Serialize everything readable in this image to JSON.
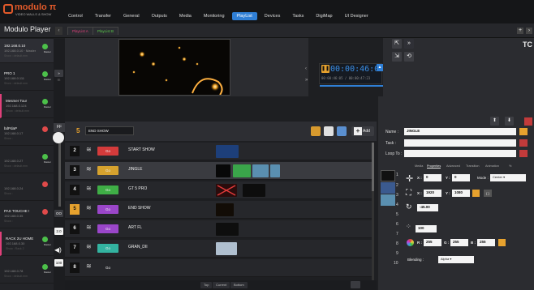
{
  "header": {
    "brand": "modulo",
    "brand_symbol": "π",
    "tagline": "VIDEO WALLS & SHOW",
    "menu": [
      "Control",
      "Transfer",
      "General",
      "Outputs",
      "Media",
      "Monitoring",
      "PlayList",
      "Devices",
      "Tasks",
      "DigiMap",
      "UI Designer"
    ],
    "active_menu": "PlayList"
  },
  "subheader": {
    "app_title": "Modulo Player",
    "collapse_icon": "chevron-left-icon",
    "tabs": [
      "PlayList A",
      "PlayList B"
    ],
    "add_label": "+",
    "next_label": "›"
  },
  "servers": [
    {
      "name": "192.168.0.10",
      "ip": "192.168.0.10 · Master",
      "status": "Show : default.mm",
      "dot": "green",
      "badge": "Master"
    },
    {
      "name": "PRO 1",
      "ip": "192.168.0.111",
      "status": "Show : default.mm",
      "dot": "green",
      "badge": "Master"
    },
    {
      "name": "Mesmer Tour",
      "ip": "192.168.0.124",
      "status": "Show : default.mm",
      "dot": "green",
      "badge": "Master"
    },
    {
      "name": "bdPdaP",
      "ip": "192.168.0.17",
      "status": "Show :",
      "dot": "red",
      "badge": ""
    },
    {
      "name": "",
      "ip": "192.168.0.27",
      "status": "Show : default.mm",
      "dot": "green",
      "badge": "Master"
    },
    {
      "name": "",
      "ip": "192.168.0.24",
      "status": "Show :",
      "dot": "red",
      "badge": ""
    },
    {
      "name": "PAS TOUCHE !",
      "ip": "192.168.0.35",
      "status": "Show :",
      "dot": "red",
      "badge": ""
    },
    {
      "name": "RACK 2U HOME",
      "ip": "192.168.0.30",
      "status": "Show : Rack 2",
      "dot": "green",
      "badge": "Master"
    },
    {
      "name": "",
      "ip": "192.168.0.78",
      "status": "Show : default.mm",
      "dot": "green",
      "badge": "Master"
    }
  ],
  "strip": {
    "ff": "FF",
    "oo": "OO",
    "speed": "2.0",
    "volume": "100"
  },
  "preview": {
    "timecode": "00:00:46:05",
    "time_sub": "00:00:46:05 / 00:00:47:23",
    "play_icon": "pause-icon",
    "up_icon": "arrow-up-icon"
  },
  "transport": {
    "tc": "TC",
    "fullscreen_icon": "expand-icon",
    "collapse_icon": "compress-icon",
    "refresh_icon": "refresh-icon"
  },
  "playlist": {
    "current_num": "5",
    "current_name": "END SHOW",
    "add_label": "Add",
    "rows": [
      {
        "num": "2",
        "go": "Go",
        "go_color": "#d43b3b",
        "title": "START SHOW",
        "active": false
      },
      {
        "num": "3",
        "go": "Go",
        "go_color": "#d6a22e",
        "title": "JINGLE",
        "active": false
      },
      {
        "num": "4",
        "go": "Go",
        "go_color": "#3fae46",
        "title": "GT 5 PRO",
        "active": false
      },
      {
        "num": "5",
        "go": "Go",
        "go_color": "#9a46c9",
        "title": "END SHOW",
        "active": true
      },
      {
        "num": "6",
        "go": "Go",
        "go_color": "#9a46c9",
        "title": "ART FL",
        "active": false
      },
      {
        "num": "7",
        "go": "Go",
        "go_color": "#33b3a0",
        "title": "GRAN_DII",
        "active": false
      },
      {
        "num": "8",
        "go": "Go",
        "go_color": "#26272b",
        "title": "",
        "active": false
      }
    ],
    "bottom_buttons": [
      "Top",
      "Current",
      "Bottom"
    ]
  },
  "props": {
    "name_label": "Name :",
    "name_value": "JINGLE",
    "task_label": "Task :",
    "task_value": "",
    "loop_label": "Loop To :",
    "loop_value": "",
    "tabs": [
      "Media",
      "Properties",
      "Advanced",
      "Transition",
      "Animation",
      "%"
    ],
    "active_tab": "Properties",
    "indexes": [
      "1",
      "2",
      "3",
      "4",
      "5",
      "6",
      "7",
      "8",
      "9",
      "10"
    ],
    "x_label": "X :",
    "x": "0",
    "y_label": "Y :",
    "y": "0",
    "mode_label": "Mode :",
    "mode": "Center",
    "w_label": "X :",
    "w": "1920",
    "h_label": "Y :",
    "h": "1080",
    "rotation": "-45.00",
    "opacity": "100",
    "r_label": "R :",
    "r": "255",
    "g_label": "G :",
    "g": "255",
    "b_label": "B :",
    "b": "255",
    "blending_label": "Blending :",
    "blending": "Alpha"
  }
}
